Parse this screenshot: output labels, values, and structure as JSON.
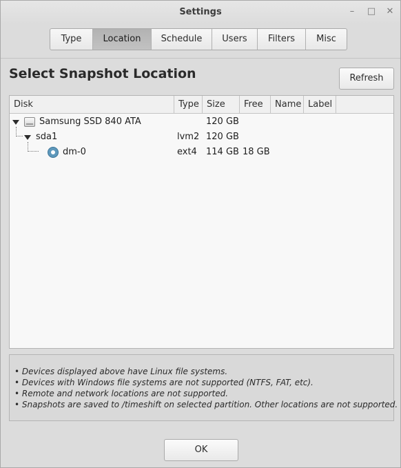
{
  "window": {
    "title": "Settings",
    "minimize_icon": "minimize-icon",
    "maximize_icon": "maximize-icon",
    "close_icon": "close-icon"
  },
  "tabs": [
    {
      "label": "Type",
      "active": false
    },
    {
      "label": "Location",
      "active": true
    },
    {
      "label": "Schedule",
      "active": false
    },
    {
      "label": "Users",
      "active": false
    },
    {
      "label": "Filters",
      "active": false
    },
    {
      "label": "Misc",
      "active": false
    }
  ],
  "page": {
    "heading": "Select Snapshot Location",
    "refresh_label": "Refresh",
    "ok_label": "OK"
  },
  "table": {
    "columns": [
      "Disk",
      "Type",
      "Size",
      "Free",
      "Name",
      "Label"
    ],
    "rows": [
      {
        "disk": "Samsung SSD 840 ATA",
        "type": "",
        "size": "120 GB",
        "free": "",
        "name": "",
        "label": "",
        "icon": "hard-disk-icon",
        "expanded": true
      },
      {
        "disk": "sda1",
        "type": "lvm2",
        "size": "120 GB",
        "free": "",
        "name": "",
        "label": "",
        "icon": "",
        "expanded": true
      },
      {
        "disk": "dm-0",
        "type": "ext4",
        "size": "114 GB",
        "free": "18 GB",
        "name": "",
        "label": "",
        "icon": "radio-selected-icon",
        "selected": true
      }
    ]
  },
  "notes": [
    "• Devices displayed above have Linux file systems.",
    "• Devices with Windows file systems are not supported (NTFS, FAT, etc).",
    "• Remote and network locations are not supported.",
    "• Snapshots are saved to /timeshift on selected partition. Other locations are not supported."
  ],
  "colors": {
    "window_bg": "#dcdcdc",
    "active_tab": "#b8b8b8",
    "radio_accent": "#5e98bb"
  }
}
